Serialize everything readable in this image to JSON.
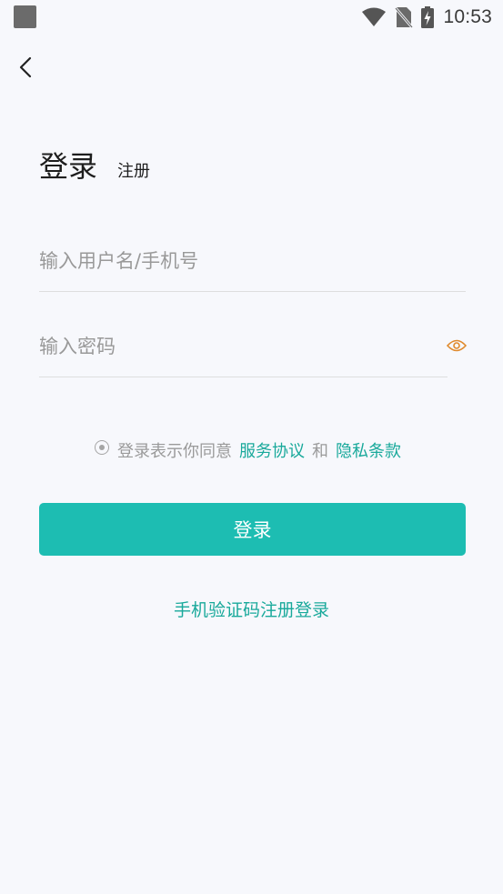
{
  "status_bar": {
    "time": "10:53",
    "icons": [
      "notification-square-icon",
      "wifi-icon",
      "no-sim-icon",
      "battery-charging-icon"
    ]
  },
  "nav": {
    "back_icon": "chevron-left-icon"
  },
  "tabs": {
    "login": "登录",
    "register": "注册"
  },
  "form": {
    "username_placeholder": "输入用户名/手机号",
    "username_value": "",
    "password_placeholder": "输入密码",
    "password_value": "",
    "password_toggle_icon": "eye-icon"
  },
  "agreement": {
    "prefix": "登录表示你同意",
    "terms_link": "服务协议",
    "conjunction": "和",
    "privacy_link": "隐私条款"
  },
  "login_button": "登录",
  "sms_login_link": "手机验证码注册登录",
  "colors": {
    "primary": "#1dbdb2",
    "link": "#19a99b",
    "eye_icon": "#e08a2c",
    "background": "#f7f8fc"
  }
}
